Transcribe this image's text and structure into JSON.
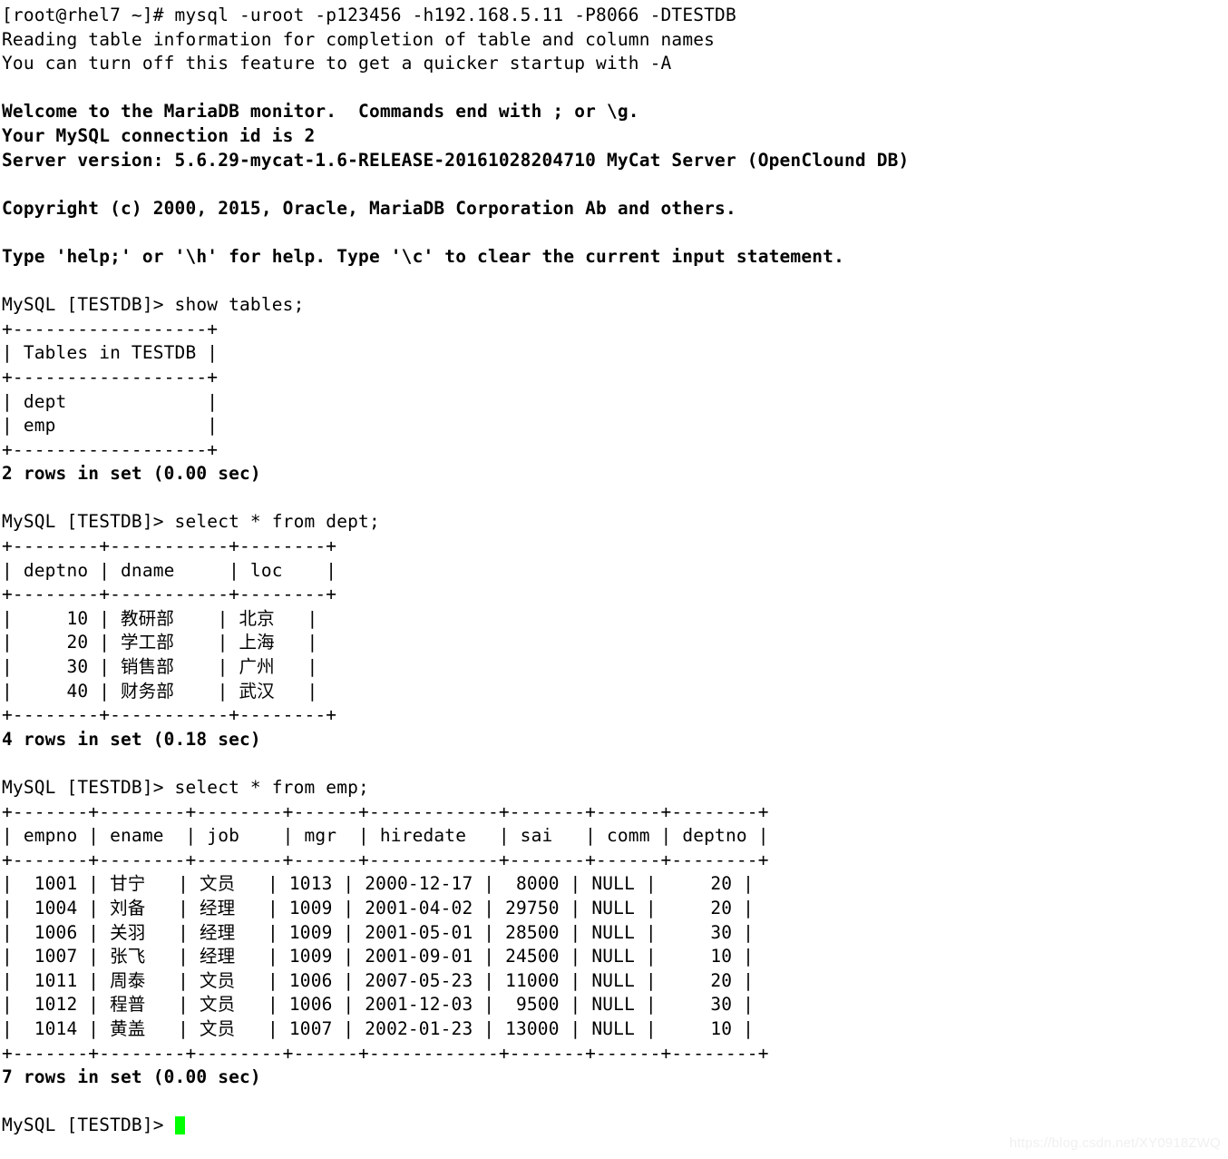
{
  "terminal": {
    "shell_prompt": "[root@rhel7 ~]#",
    "command": "mysql -uroot -p123456 -h192.168.5.11 -P8066 -DTESTDB",
    "cursor_color": "#00ff00",
    "foreground_color": "#000000",
    "background_color": "#ffffff",
    "lines": [
      {
        "id": "shell-command",
        "text": "[root@rhel7 ~]# mysql -uroot -p123456 -h192.168.5.11 -P8066 -DTESTDB",
        "bold": false
      },
      {
        "id": "reading-table-info",
        "text": "Reading table information for completion of table and column names",
        "bold": false
      },
      {
        "id": "turn-off-hint",
        "text": "You can turn off this feature to get a quicker startup with -A",
        "bold": false
      },
      {
        "id": "blank-1",
        "text": " ",
        "bold": false
      },
      {
        "id": "welcome-banner",
        "text": "Welcome to the MariaDB monitor.  Commands end with ; or \\g.",
        "bold": true
      },
      {
        "id": "connection-id",
        "text": "Your MySQL connection id is 2",
        "bold": true
      },
      {
        "id": "server-version",
        "text": "Server version: 5.6.29-mycat-1.6-RELEASE-20161028204710 MyCat Server (OpenClound DB)",
        "bold": true
      },
      {
        "id": "blank-2",
        "text": " ",
        "bold": false
      },
      {
        "id": "copyright",
        "text": "Copyright (c) 2000, 2015, Oracle, MariaDB Corporation Ab and others.",
        "bold": true
      },
      {
        "id": "blank-3",
        "text": " ",
        "bold": false
      },
      {
        "id": "help-hint",
        "text": "Type 'help;' or '\\h' for help. Type '\\c' to clear the current input statement.",
        "bold": true
      },
      {
        "id": "blank-4",
        "text": " ",
        "bold": false
      },
      {
        "id": "prompt-show-tables",
        "text": "MySQL [TESTDB]> show tables;",
        "bold": false
      },
      {
        "id": "tables-border-top",
        "text": "+------------------+",
        "bold": false
      },
      {
        "id": "tables-header",
        "text": "| Tables in TESTDB |",
        "bold": false
      },
      {
        "id": "tables-border-mid",
        "text": "+------------------+",
        "bold": false
      },
      {
        "id": "tables-row-dept",
        "text": "| dept             |",
        "bold": false
      },
      {
        "id": "tables-row-emp",
        "text": "| emp              |",
        "bold": false
      },
      {
        "id": "tables-border-bot",
        "text": "+------------------+",
        "bold": false
      },
      {
        "id": "tables-rowcount",
        "text": "2 rows in set (0.00 sec)",
        "bold": true
      },
      {
        "id": "blank-5",
        "text": " ",
        "bold": false
      },
      {
        "id": "prompt-select-dept",
        "text": "MySQL [TESTDB]> select * from dept;",
        "bold": false
      },
      {
        "id": "dept-border-top",
        "text": "+--------+-----------+--------+",
        "bold": false
      },
      {
        "id": "dept-header",
        "text": "| deptno | dname     | loc    |",
        "bold": false
      },
      {
        "id": "dept-border-mid",
        "text": "+--------+-----------+--------+",
        "bold": false
      },
      {
        "id": "dept-row-1",
        "text": "|     10 | 教研部    | 北京   |",
        "bold": false
      },
      {
        "id": "dept-row-2",
        "text": "|     20 | 学工部    | 上海   |",
        "bold": false
      },
      {
        "id": "dept-row-3",
        "text": "|     30 | 销售部    | 广州   |",
        "bold": false
      },
      {
        "id": "dept-row-4",
        "text": "|     40 | 财务部    | 武汉   |",
        "bold": false
      },
      {
        "id": "dept-border-bot",
        "text": "+--------+-----------+--------+",
        "bold": false
      },
      {
        "id": "dept-rowcount",
        "text": "4 rows in set (0.18 sec)",
        "bold": true
      },
      {
        "id": "blank-6",
        "text": " ",
        "bold": false
      },
      {
        "id": "prompt-select-emp",
        "text": "MySQL [TESTDB]> select * from emp;",
        "bold": false
      },
      {
        "id": "emp-border-top",
        "text": "+-------+--------+--------+------+------------+-------+------+--------+",
        "bold": false
      },
      {
        "id": "emp-header",
        "text": "| empno | ename  | job    | mgr  | hiredate   | sai   | comm | deptno |",
        "bold": false
      },
      {
        "id": "emp-border-mid",
        "text": "+-------+--------+--------+------+------------+-------+------+--------+",
        "bold": false
      },
      {
        "id": "emp-row-1",
        "text": "|  1001 | 甘宁   | 文员   | 1013 | 2000-12-17 |  8000 | NULL |     20 |",
        "bold": false
      },
      {
        "id": "emp-row-2",
        "text": "|  1004 | 刘备   | 经理   | 1009 | 2001-04-02 | 29750 | NULL |     20 |",
        "bold": false
      },
      {
        "id": "emp-row-3",
        "text": "|  1006 | 关羽   | 经理   | 1009 | 2001-05-01 | 28500 | NULL |     30 |",
        "bold": false
      },
      {
        "id": "emp-row-4",
        "text": "|  1007 | 张飞   | 经理   | 1009 | 2001-09-01 | 24500 | NULL |     10 |",
        "bold": false
      },
      {
        "id": "emp-row-5",
        "text": "|  1011 | 周泰   | 文员   | 1006 | 2007-05-23 | 11000 | NULL |     20 |",
        "bold": false
      },
      {
        "id": "emp-row-6",
        "text": "|  1012 | 程普   | 文员   | 1006 | 2001-12-03 |  9500 | NULL |     30 |",
        "bold": false
      },
      {
        "id": "emp-row-7",
        "text": "|  1014 | 黄盖   | 文员   | 1007 | 2002-01-23 | 13000 | NULL |     10 |",
        "bold": false
      },
      {
        "id": "emp-border-bot",
        "text": "+-------+--------+--------+------+------------+-------+------+--------+",
        "bold": false
      },
      {
        "id": "emp-rowcount",
        "text": "7 rows in set (0.00 sec)",
        "bold": true
      },
      {
        "id": "blank-7",
        "text": " ",
        "bold": false
      },
      {
        "id": "final-prompt",
        "text": "MySQL [TESTDB]> ",
        "bold": false,
        "cursor": true
      }
    ],
    "tables": {
      "show_tables": {
        "columns": [
          "Tables in TESTDB"
        ],
        "rows": [
          [
            "dept"
          ],
          [
            "emp"
          ]
        ],
        "rowcount_text": "2 rows in set (0.00 sec)"
      },
      "dept": {
        "columns": [
          "deptno",
          "dname",
          "loc"
        ],
        "rows": [
          [
            "10",
            "教研部",
            "北京"
          ],
          [
            "20",
            "学工部",
            "上海"
          ],
          [
            "30",
            "销售部",
            "广州"
          ],
          [
            "40",
            "财务部",
            "武汉"
          ]
        ],
        "rowcount_text": "4 rows in set (0.18 sec)"
      },
      "emp": {
        "columns": [
          "empno",
          "ename",
          "job",
          "mgr",
          "hiredate",
          "sai",
          "comm",
          "deptno"
        ],
        "rows": [
          [
            "1001",
            "甘宁",
            "文员",
            "1013",
            "2000-12-17",
            "8000",
            "NULL",
            "20"
          ],
          [
            "1004",
            "刘备",
            "经理",
            "1009",
            "2001-04-02",
            "29750",
            "NULL",
            "20"
          ],
          [
            "1006",
            "关羽",
            "经理",
            "1009",
            "2001-05-01",
            "28500",
            "NULL",
            "30"
          ],
          [
            "1007",
            "张飞",
            "经理",
            "1009",
            "2001-09-01",
            "24500",
            "NULL",
            "10"
          ],
          [
            "1011",
            "周泰",
            "文员",
            "1006",
            "2007-05-23",
            "11000",
            "NULL",
            "20"
          ],
          [
            "1012",
            "程普",
            "文员",
            "1006",
            "2001-12-03",
            "9500",
            "NULL",
            "30"
          ],
          [
            "1014",
            "黄盖",
            "文员",
            "1007",
            "2002-01-23",
            "13000",
            "NULL",
            "10"
          ]
        ],
        "rowcount_text": "7 rows in set (0.00 sec)"
      }
    }
  },
  "watermark": {
    "text": "https://blog.csdn.net/XY0918ZWQ"
  }
}
